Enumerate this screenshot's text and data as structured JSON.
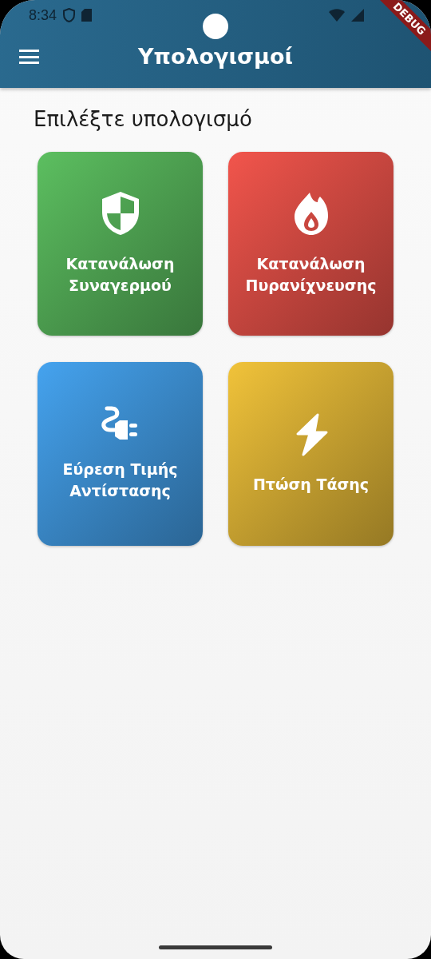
{
  "status_bar": {
    "time": "8:34"
  },
  "debug_banner": "DEBUG",
  "app_bar": {
    "title": "Υπολογισμοί"
  },
  "heading": "Επιλέξτε υπολογισμό",
  "cards": [
    {
      "kind": "shield",
      "label": "Κατανάλωση Συναγερμού",
      "color": "#5cbf60"
    },
    {
      "kind": "fire",
      "label": "Κατανάλωση Πυρανίχνευσης",
      "color": "#f2554c"
    },
    {
      "kind": "plug",
      "label": "Εύρεση Τιμής Αντίστασης",
      "color": "#45a3ef"
    },
    {
      "kind": "bolt",
      "label": "Πτώση Τάσης",
      "color": "#f1c33a"
    }
  ]
}
